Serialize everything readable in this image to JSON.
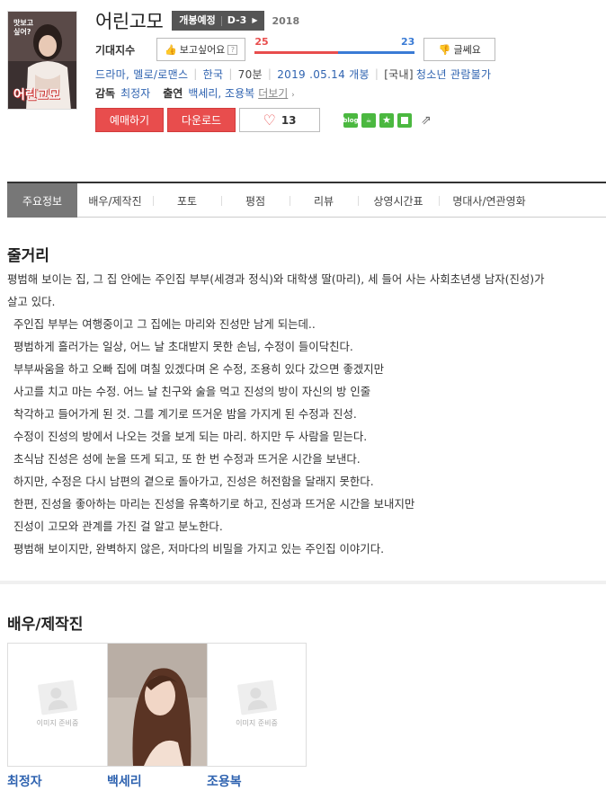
{
  "movie": {
    "title": "어린고모",
    "badge_status": "개봉예정",
    "badge_dday": "D-3",
    "year": "2018",
    "poster_text_top": "맛보고 싶어?",
    "poster_text_title": "어린고모"
  },
  "expectation": {
    "label": "기대지수",
    "want_label": "보고싶어요",
    "want_count": "25",
    "dislike_count": "23",
    "want_ratio": 0.52,
    "dislike_label": "글쎄요"
  },
  "meta": {
    "genre": "드라마, 멜로/로맨스",
    "country": "한국",
    "runtime": "70분",
    "release": "2019 .05.14 개봉",
    "rating_prefix": "[국내]",
    "rating": "청소년 관람불가"
  },
  "credits": {
    "director_label": "감독",
    "director": "최정자",
    "cast_label": "출연",
    "cast": "백세리, 조용복",
    "more": "더보기"
  },
  "actions": {
    "reserve": "예매하기",
    "download": "다운로드",
    "like_count": "13"
  },
  "tabs": [
    "주요정보",
    "배우/제작진",
    "포토",
    "평점",
    "리뷰",
    "상영시간표",
    "명대사/연관영화"
  ],
  "synopsis": {
    "heading": "줄거리",
    "lines": [
      "평범해 보이는 집, 그 집 안에는 주인집 부부(세경과 정식)와 대학생 딸(마리), 세 들어 사는 사회초년생 남자(진성)가",
      "살고 있다.",
      "주인집 부부는 여행중이고 그 집에는 마리와 진성만 남게 되는데..",
      "평범하게 흘러가는 일상, 어느 날 초대받지 못한 손님, 수정이 들이닥친다.",
      "부부싸움을 하고 오빠 집에 며칠 있겠다며 온 수정, 조용히 있다 갔으면 좋겠지만",
      "사고를 치고 마는 수정. 어느 날 친구와 술을 먹고 진성의 방이 자신의 방 인줄",
      "착각하고 들어가게 된 것. 그를 계기로 뜨거운 밤을 가지게 된 수정과 진성.",
      "수정이 진성의 방에서 나오는 것을 보게 되는 마리. 하지만 두 사람을 믿는다.",
      "초식남 진성은 성에 눈을 뜨게 되고, 또 한 번 수정과 뜨거운 시간을 보낸다.",
      "하지만, 수정은 다시 남편의 곁으로 돌아가고, 진성은 허전함을 달래지 못한다.",
      "한편, 진성을 좋아하는 마리는 진성을 유혹하기로 하고, 진성과 뜨거운 시간을 보내지만",
      "진성이 고모와 관계를 가진 걸 알고 분노한다.",
      "평범해 보이지만, 완벽하지 않은, 저마다의 비밀을 가지고 있는 주인집 이야기다."
    ]
  },
  "cast_section": {
    "heading": "배우/제작진",
    "placeholder": "이미지 준비중",
    "people": [
      "최정자",
      "백세리",
      "조용복"
    ]
  }
}
